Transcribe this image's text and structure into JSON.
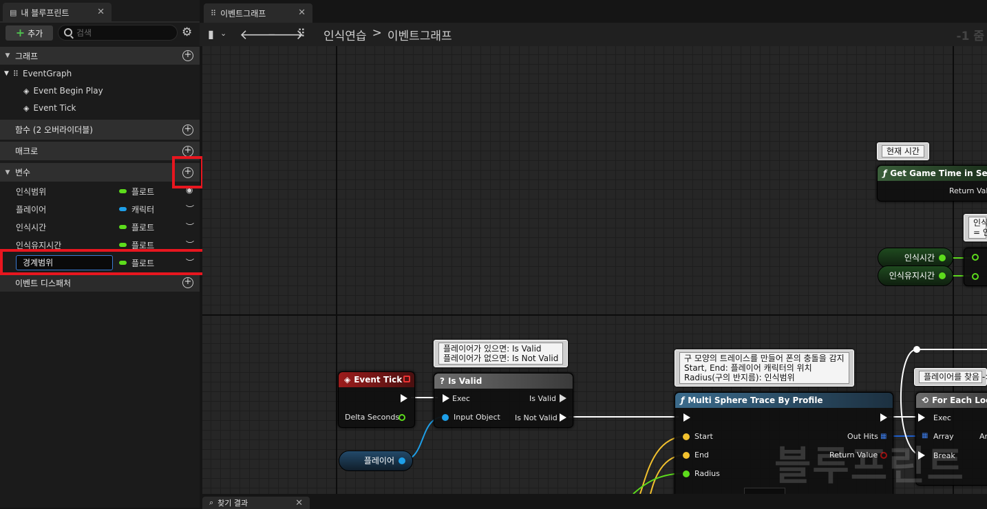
{
  "left_panel": {
    "tab_title": "내 블루프린트",
    "add_label": "추가",
    "search_placeholder": "검색",
    "sections": {
      "graphs": "그래프",
      "functions": "함수 (2 오버라이더블)",
      "macros": "매크로",
      "variables": "변수",
      "dispatchers": "이벤트 디스패처"
    },
    "graph_items": [
      "EventGraph",
      "Event Begin Play",
      "Event Tick"
    ],
    "variables": [
      {
        "name": "인식범위",
        "type": "플로트",
        "color": "#5ddc1c",
        "visible": true
      },
      {
        "name": "플레이어",
        "type": "캐릭터",
        "color": "#1e9fe8",
        "visible": false
      },
      {
        "name": "인식시간",
        "type": "플로트",
        "color": "#5ddc1c",
        "visible": false
      },
      {
        "name": "인식유지시간",
        "type": "플로트",
        "color": "#5ddc1c",
        "visible": false
      },
      {
        "name": "경계범위",
        "type": "플로트",
        "color": "#5ddc1c",
        "visible": false,
        "editing": true
      }
    ]
  },
  "graph": {
    "tab_title": "이벤트그래프",
    "breadcrumb": [
      "인식연습",
      "이벤트그래프"
    ],
    "zoom": "-1 줌",
    "bottom_tab": "찾기 결과",
    "watermark": "블루프린트",
    "nodes": {
      "event_tick": {
        "title": "Event Tick",
        "pin": "Delta Seconds"
      },
      "is_valid": {
        "title": "Is Valid",
        "exec": "Exec",
        "input": "Input Object",
        "out_valid": "Is Valid",
        "out_not_valid": "Is Not Valid"
      },
      "player_var": "플레이어",
      "sphere_trace": {
        "title": "Multi Sphere Trace By Profile",
        "start": "Start",
        "end": "End",
        "radius": "Radius",
        "out_hits": "Out Hits",
        "return_value": "Return Value"
      },
      "foreach": {
        "title": "For Each Loop",
        "exec": "Exec",
        "array": "Array",
        "break": "Break",
        "out": "Arr"
      },
      "game_time": {
        "title": "Get Game Time in Second",
        "return": "Return Valu"
      },
      "var_recog_time": "인식시간",
      "var_recog_keep": "인식유지시간"
    },
    "comments": {
      "is_valid": [
        "플레이어가 있으면: Is Valid",
        "플레이어가 없으면: Is Not Valid"
      ],
      "trace": [
        "구 모양의 트레이스를 만들어 폰의 충돌을 감지",
        "Start, End: 플레이어 캐릭터의 위치",
        "Radius(구의 반지름): 인식범위"
      ],
      "current_time": "현재 시간",
      "found_player": "플레이어를 찾음 ->",
      "top_right": [
        "인식",
        "= 인식"
      ]
    }
  },
  "colors": {
    "highlight": "#e8161f",
    "float_pin": "#5ddc1c",
    "object_pin": "#1e9fe8",
    "vector_pin": "#f2c12e"
  }
}
